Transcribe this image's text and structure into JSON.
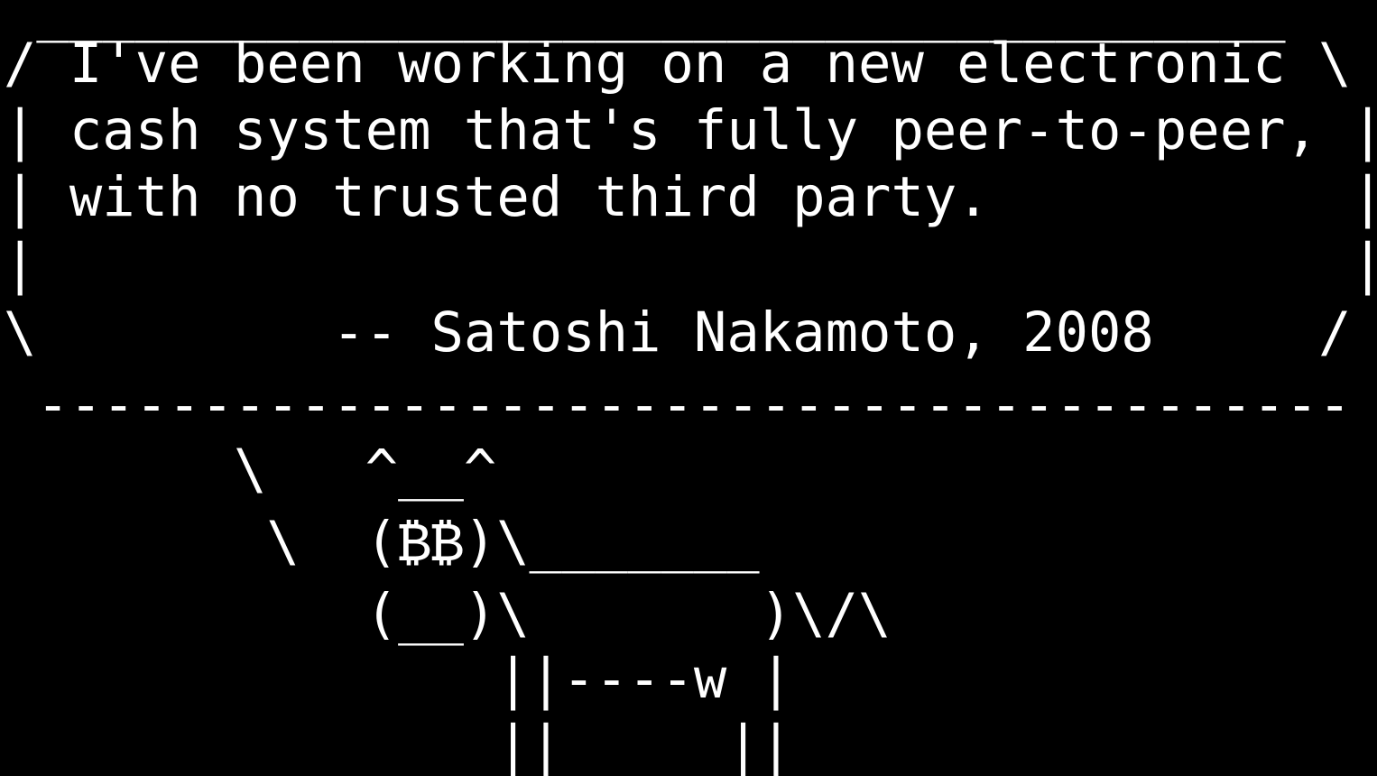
{
  "terminal": {
    "background": "#000000",
    "foreground": "#ffffff",
    "lines": [
      " ______________________________________",
      "/ I've been working on a new electronic \\",
      "| cash system that's fully peer-to-peer, |",
      "| with no trusted third party.           |",
      "|                                        |",
      "\\         -- Satoshi Nakamoto, 2008     /",
      " ----------------------------------------",
      "       \\   ^__^",
      "        \\  (₿₿)\\_______",
      "           (__)\\       )\\/\\",
      "               ||----w |",
      "               ||     ||"
    ]
  }
}
